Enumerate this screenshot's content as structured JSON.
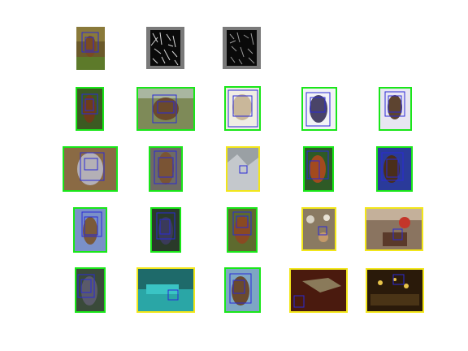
{
  "figure": {
    "query": {
      "photo": {
        "scene": "horse-head-field"
      },
      "feature_maps": [
        {
          "name": "feature-map-1",
          "frame": "gray"
        },
        {
          "name": "feature-map-2",
          "frame": "gray"
        }
      ]
    },
    "legend_colors": {
      "correct": "#19e619",
      "incorrect": "#f2e61a",
      "detection_box": "#2a2ad6"
    },
    "retrieval_rows": [
      [
        {
          "label": "correct",
          "scene": "horse-dark-grass"
        },
        {
          "label": "correct",
          "scene": "horse-paddock-fence"
        },
        {
          "label": "correct",
          "scene": "horse-white-sketch"
        },
        {
          "label": "correct",
          "scene": "horse-white-bg"
        },
        {
          "label": "correct",
          "scene": "horse-gray-light"
        }
      ],
      [
        {
          "label": "correct",
          "scene": "horse-gray-brown-bg"
        },
        {
          "label": "correct",
          "scene": "horse-portrait-gray"
        },
        {
          "label": "incorrect",
          "scene": "snow-rocks"
        },
        {
          "label": "correct",
          "scene": "horse-green-field"
        },
        {
          "label": "correct",
          "scene": "horse-dark-blue"
        }
      ],
      [
        {
          "label": "correct",
          "scene": "horse-blue-sky"
        },
        {
          "label": "correct",
          "scene": "horse-dark-forest"
        },
        {
          "label": "correct",
          "scene": "horse-brown-grass"
        },
        {
          "label": "incorrect",
          "scene": "food-table"
        },
        {
          "label": "incorrect",
          "scene": "people-living-room"
        }
      ],
      [
        {
          "label": "correct",
          "scene": "horse-trees-dark"
        },
        {
          "label": "incorrect",
          "scene": "teal-couch"
        },
        {
          "label": "correct",
          "scene": "horse-blue-water"
        },
        {
          "label": "incorrect",
          "scene": "dark-red-room"
        },
        {
          "label": "incorrect",
          "scene": "dark-dinner-table"
        }
      ]
    ]
  }
}
